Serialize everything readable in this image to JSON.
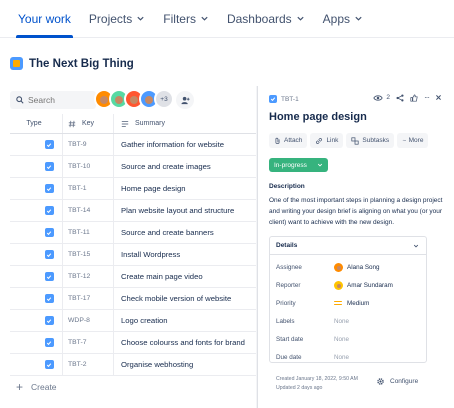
{
  "nav": {
    "items": [
      {
        "label": "Your work",
        "active": true,
        "dropdown": false
      },
      {
        "label": "Projects",
        "active": false,
        "dropdown": true
      },
      {
        "label": "Filters",
        "active": false,
        "dropdown": true
      },
      {
        "label": "Dashboards",
        "active": false,
        "dropdown": true
      },
      {
        "label": "Apps",
        "active": false,
        "dropdown": true
      }
    ]
  },
  "project": {
    "title": "The Next Big Thing"
  },
  "search": {
    "placeholder": "Search"
  },
  "avatars": {
    "more_label": "+3",
    "colors": [
      "#ff8b00",
      "#57d9a3",
      "#ff5630",
      "#4c9aff"
    ]
  },
  "table": {
    "headers": {
      "type": "Type",
      "key": "Key",
      "summary": "Summary"
    },
    "rows": [
      {
        "key": "TBT-9",
        "summary": "Gather information for website",
        "selected": false
      },
      {
        "key": "TBT-10",
        "summary": "Source and create images",
        "selected": false
      },
      {
        "key": "TBT-1",
        "summary": "Home page design",
        "selected": false
      },
      {
        "key": "TBT-14",
        "summary": "Plan website layout and structure",
        "selected": false
      },
      {
        "key": "TBT-11",
        "summary": "Source and create banners",
        "selected": false
      },
      {
        "key": "TBT-15",
        "summary": "Install Wordpress",
        "selected": false
      },
      {
        "key": "TBT-12",
        "summary": "Create main page video",
        "selected": false
      },
      {
        "key": "TBT-17",
        "summary": "Check mobile version of website",
        "selected": false
      },
      {
        "key": "WDP-8",
        "summary": "Logo creation",
        "selected": false
      },
      {
        "key": "TBT-7",
        "summary": "Choose colourss and fonts for brand",
        "selected": false
      },
      {
        "key": "TBT-2",
        "summary": "Organise webhosting",
        "selected": false
      }
    ]
  },
  "create": {
    "label": "Create"
  },
  "detail": {
    "issue_key": "TBT-1",
    "watchers": "2",
    "title": "Home page design",
    "buttons": {
      "attach": "Attach",
      "link": "Link",
      "subtasks": "Subtasks",
      "more": "More"
    },
    "status": "In-progress",
    "description_label": "Description",
    "description": "One of the most important steps in planning a design project and writing your design brief is aligning on what you (or your client) want to achieve with the new design.",
    "details": {
      "header": "Details",
      "assignee_label": "Assignee",
      "assignee": "Alana Song",
      "reporter_label": "Reporter",
      "reporter": "Amar Sundaram",
      "priority_label": "Priority",
      "priority": "Medium",
      "labels_label": "Labels",
      "labels": "None",
      "start_label": "Start date",
      "start": "None",
      "due_label": "Due date",
      "due": "None"
    },
    "created": "Created January 18, 2022, 9:50 AM",
    "updated": "Updated 2 days ago",
    "configure": "Configure"
  },
  "colors": {
    "accent": "#0052cc",
    "status": "#36b37e",
    "checkbox": "#4c9aff"
  }
}
